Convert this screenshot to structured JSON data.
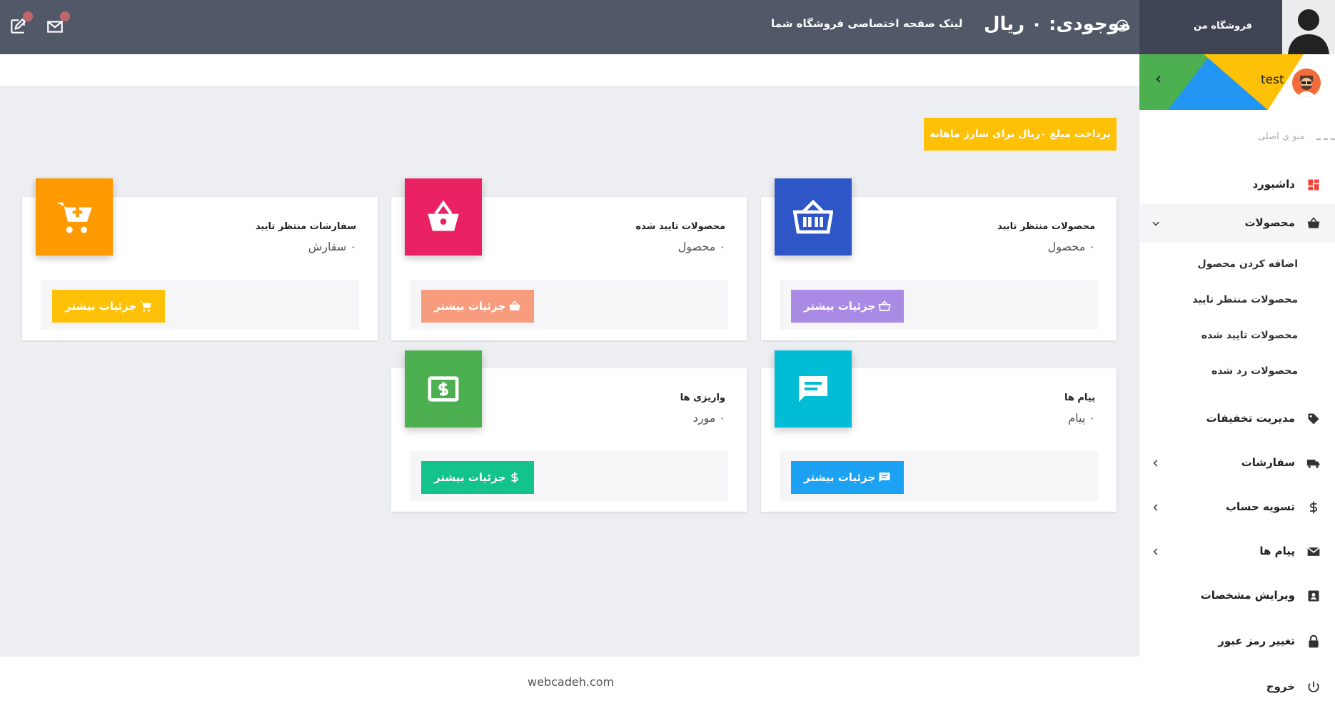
{
  "topbar": {
    "store_link": "لینک صفحه اختصاصی فروشگاه شما",
    "balance": "موجودی: ۰ ریال"
  },
  "sidebar": {
    "store_title": "فروشگاه من",
    "username": "test",
    "menu_heading": "منو ی اصلی",
    "items": {
      "dashboard": "داشبورد",
      "products": "محصولات",
      "discounts": "مدیریت تخفیفات",
      "orders": "سفارشات",
      "settlement": "تسویه حساب",
      "messages": "پیام ها",
      "edit_profile": "ویرایش مشخصات",
      "change_password": "تغییر رمز عبور",
      "logout": "خروج"
    },
    "products_sub": {
      "add": "اضافه کردن محصول",
      "pending": "محصولات منتظر تایید",
      "approved": "محصولات تایید شده",
      "rejected": "محصولات رد شده"
    }
  },
  "content": {
    "pay_button": "پرداخت مبلغ ۰ریال برای شارژ ماهانه",
    "more_label": "جزئیات بیشتر",
    "cards": {
      "pending_products": {
        "title": "محصولات منتظر تایید",
        "value": "۰ محصول",
        "icon_color": "#2e56c7",
        "btn_color": "#a98be6"
      },
      "approved_products": {
        "title": "محصولات تایید شده",
        "value": "۰ محصول",
        "icon_color": "#ea2264",
        "btn_color": "#f89c7e"
      },
      "pending_orders": {
        "title": "سفارشات منتظر تایید",
        "value": "۰ سفارش",
        "icon_color": "#ff9a00",
        "btn_color": "#ffc107"
      },
      "messages": {
        "title": "پیام ها",
        "value": "۰ پیام",
        "icon_color": "#00bcd4",
        "btn_color": "#1da1f2"
      },
      "deposits": {
        "title": "واریزی ها",
        "value": "۰ مورد",
        "icon_color": "#4caf50",
        "btn_color": "#13c38b"
      }
    }
  },
  "footer": {
    "text": "webcadeh.com"
  }
}
